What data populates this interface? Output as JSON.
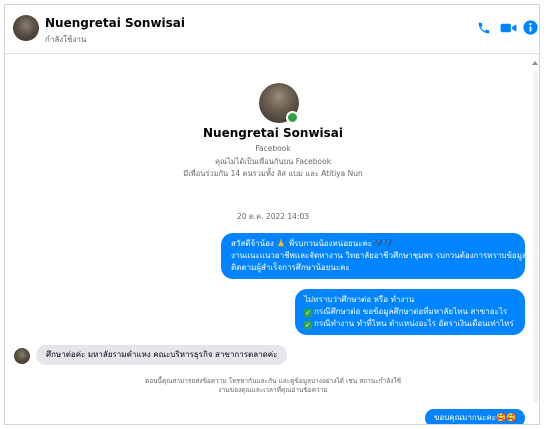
{
  "header": {
    "name": "Nuengretai Sonwisai",
    "status": "กำลังใช้งาน",
    "actions": [
      "phone-icon",
      "video-camera-icon",
      "info-icon"
    ]
  },
  "profile": {
    "name": "Nuengretai Sonwisai",
    "platform": "Facebook",
    "not_friends": "คุณไม่ได้เป็นเพื่อนกันบน Facebook",
    "mutual": "มีเพื่อนร่วมกัน 14 คนรวมทั้ง ลัส แบม และ Atitiya Nun"
  },
  "timestamp": "20 ต.ค. 2022 14:03",
  "messages": {
    "m1": [
      "สวัสดีจ้าน้อง 🙏 พี่รบกวนน้องหน่อยนะคะ💙💙",
      "งานแนะแนวอาชีพและจัดหางาน วิทยาลัยอาชีวศึกษาชุมพร รบกวนต้องการทราบข้อมูลการ",
      "ติดตามผู้สำเร็จการศึกษาน้อยนะคะ"
    ],
    "m2": [
      "ไม่ทราบว่าศึกษาต่อ หรือ ทำงาน",
      "กรณีศึกษาต่อ ขอข้อมูลศึกษาต่อที่มหาลัยไหน สาขาอะไร",
      "กรณีทำงาน ทำที่ไหน ตำแหน่งอะไร อัตราเงินเดือนเท่าไหร่"
    ],
    "reply": "ศึกษาต่อค่ะ มหาลัยรามคำแหง คณะบริหารธุรกิจ สาขาการตลาดค่ะ",
    "system": [
      "ตอนนี้คุณสามารถส่งข้อความ โทรหากันและกัน และดูข้อมูลบางอย่างได้ เช่น สถานะกำลังใช้",
      "งานของคุณและเวลาที่คุณอ่านข้อความ"
    ],
    "thanks": "ขอบคุณมากนะคะ🥰🥰"
  },
  "colors": {
    "accent": "#0084ff",
    "incoming": "#e4e6eb",
    "online": "#31a24c"
  }
}
